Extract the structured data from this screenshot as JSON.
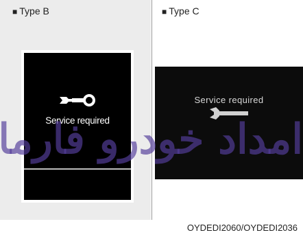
{
  "panels": {
    "type_b": {
      "label": "Type B",
      "message": "Service required"
    },
    "type_c": {
      "label": "Type C",
      "message": "Service required"
    }
  },
  "square_glyph": "■",
  "watermark": "امداد خودرو فارما",
  "footer_code": "OYDEDI2060/OYDEDI2036",
  "icons": [
    "wrench-icon",
    "wrench-icon"
  ]
}
